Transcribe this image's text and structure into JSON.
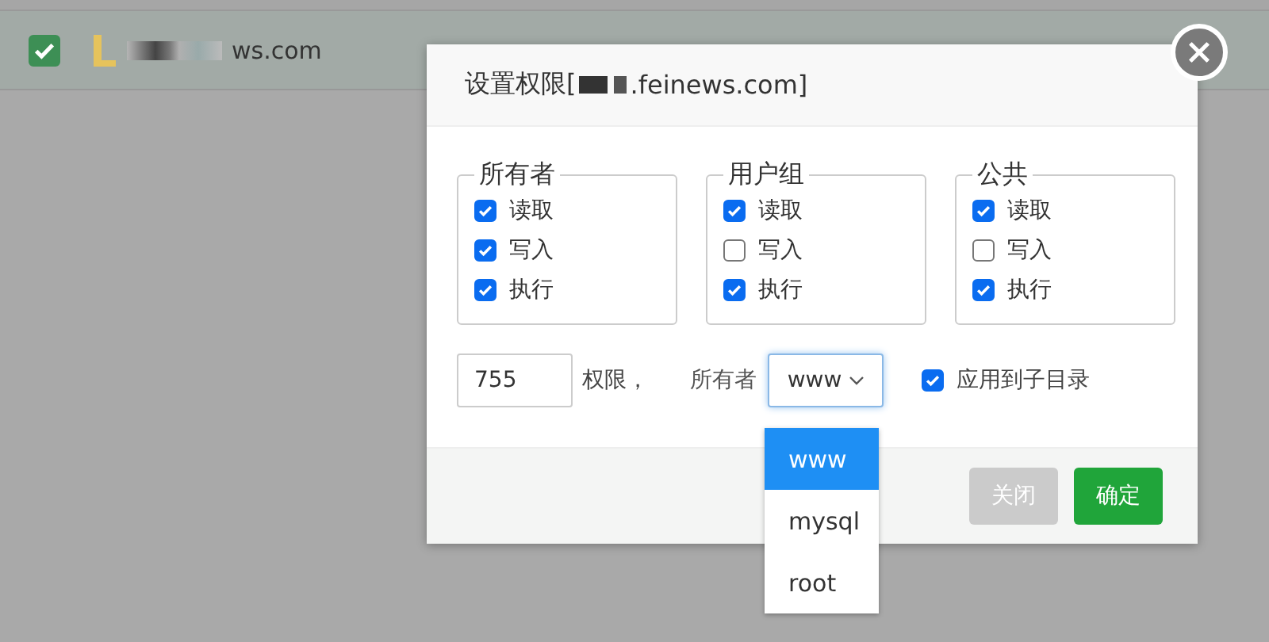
{
  "background_row": {
    "checked": true,
    "name": "ws.com"
  },
  "dialog": {
    "title_prefix": "设置权限[",
    "title_suffix": ".feinews.com]",
    "groups": [
      {
        "legend": "所有者",
        "permissions": [
          {
            "label": "读取",
            "checked": true
          },
          {
            "label": "写入",
            "checked": true
          },
          {
            "label": "执行",
            "checked": true
          }
        ]
      },
      {
        "legend": "用户组",
        "permissions": [
          {
            "label": "读取",
            "checked": true
          },
          {
            "label": "写入",
            "checked": false
          },
          {
            "label": "执行",
            "checked": true
          }
        ]
      },
      {
        "legend": "公共",
        "permissions": [
          {
            "label": "读取",
            "checked": true
          },
          {
            "label": "写入",
            "checked": false
          },
          {
            "label": "执行",
            "checked": true
          }
        ]
      }
    ],
    "mode_value": "755",
    "mode_label": "权限，",
    "owner_label": "所有者",
    "owner_select": {
      "value": "www",
      "options": [
        {
          "label": "www",
          "selected": true
        },
        {
          "label": "mysql",
          "selected": false
        },
        {
          "label": "root",
          "selected": false
        }
      ]
    },
    "apply_to_subdirs": {
      "label": "应用到子目录",
      "checked": true
    },
    "buttons": [
      {
        "label": "关闭",
        "kind": "secondary"
      },
      {
        "label": "确定",
        "kind": "primary"
      }
    ]
  }
}
